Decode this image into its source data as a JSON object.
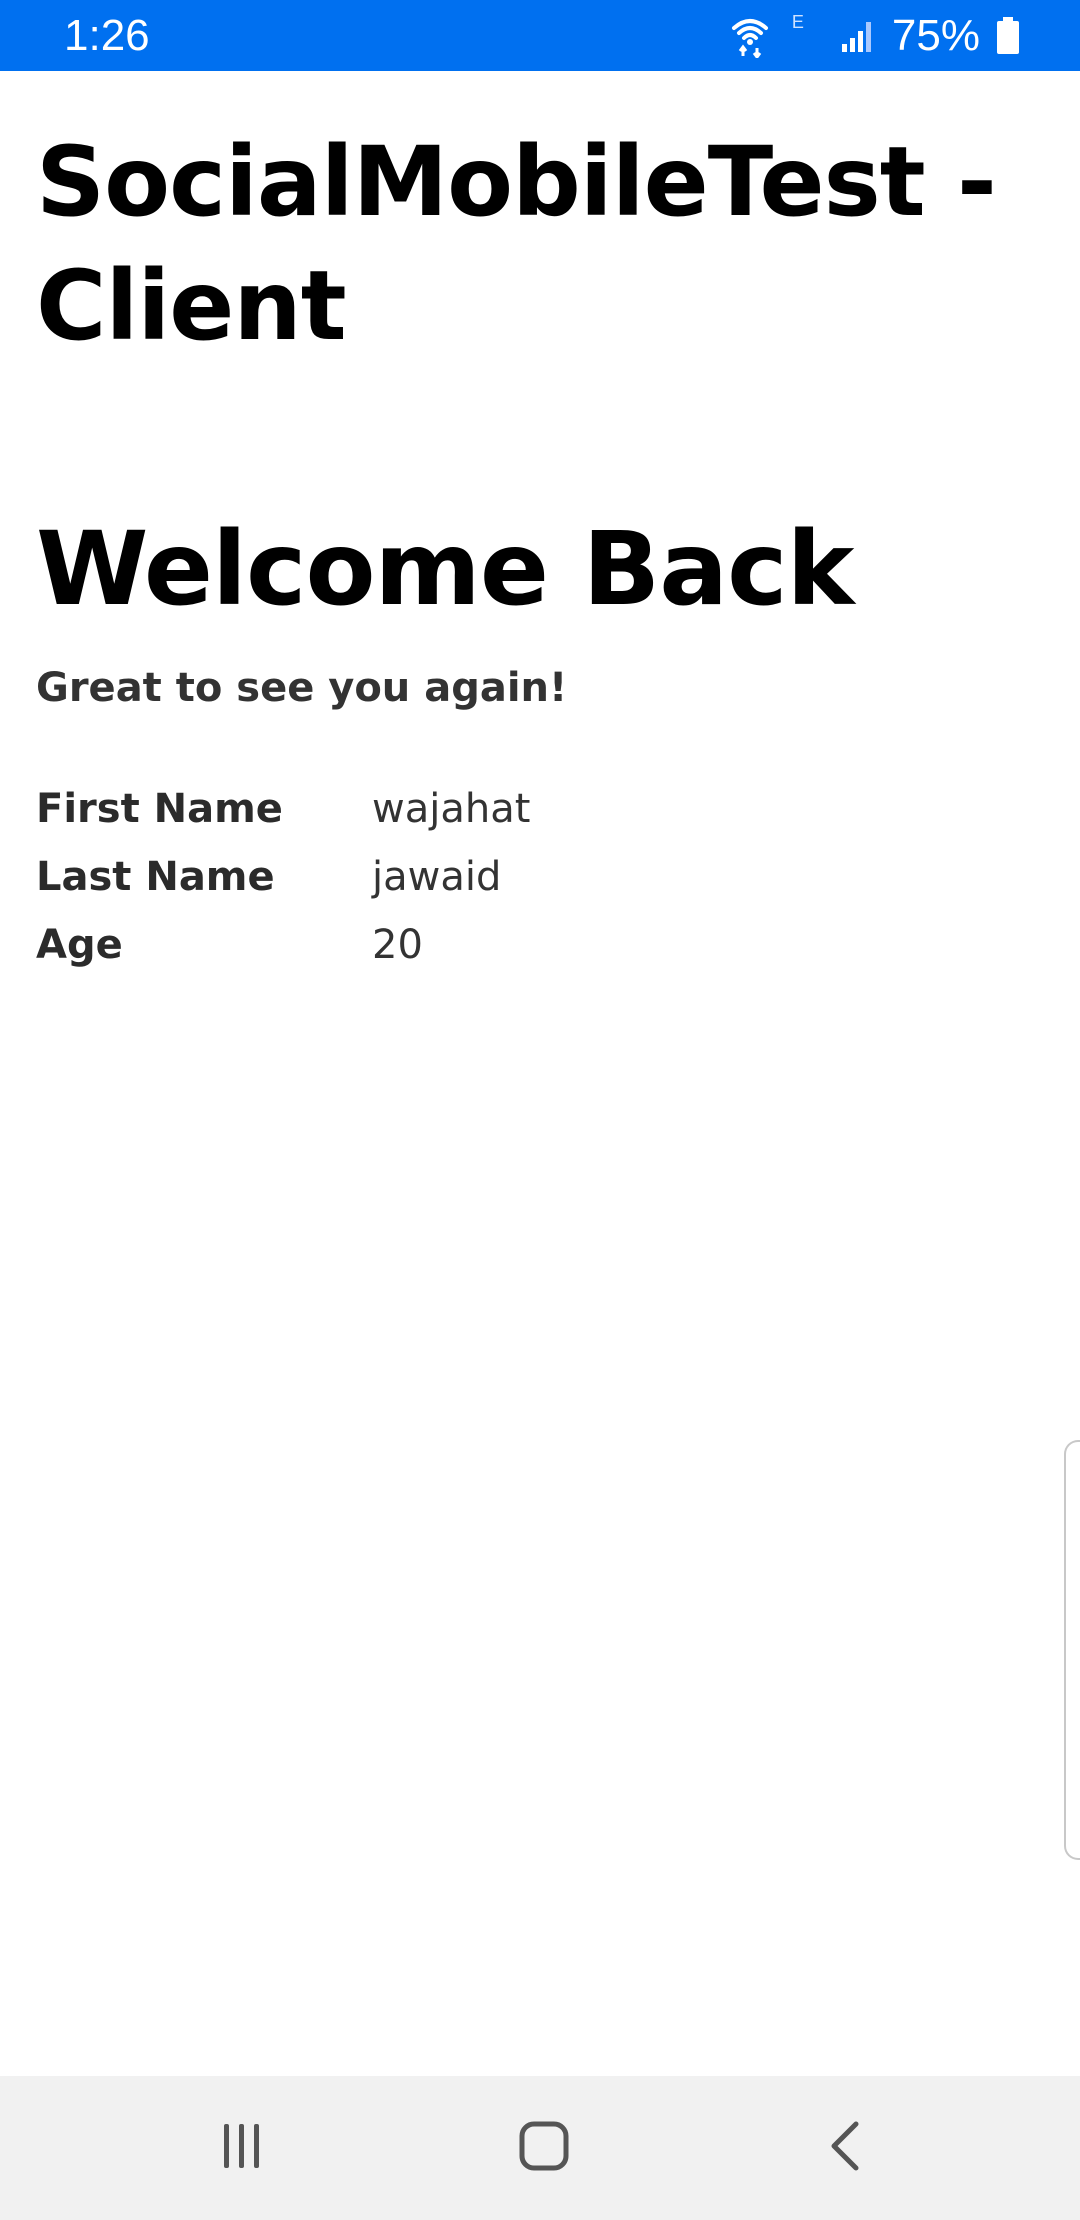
{
  "status_bar": {
    "time": "1:26",
    "network_type": "E",
    "battery_percent": "75%",
    "icons": [
      "wifi-icon",
      "signal-icon",
      "battery-icon"
    ],
    "background_color": "#0070f0"
  },
  "app": {
    "title": "SocialMobileTest - Client"
  },
  "welcome": {
    "title": "Welcome Back",
    "subtitle": "Great to see you again!"
  },
  "profile": {
    "fields": [
      {
        "label": "First Name",
        "value": "wajahat"
      },
      {
        "label": "Last Name",
        "value": "jawaid"
      },
      {
        "label": "Age",
        "value": "20"
      }
    ]
  },
  "nav_bar": {
    "buttons": [
      "recents-icon",
      "home-icon",
      "back-icon"
    ]
  }
}
